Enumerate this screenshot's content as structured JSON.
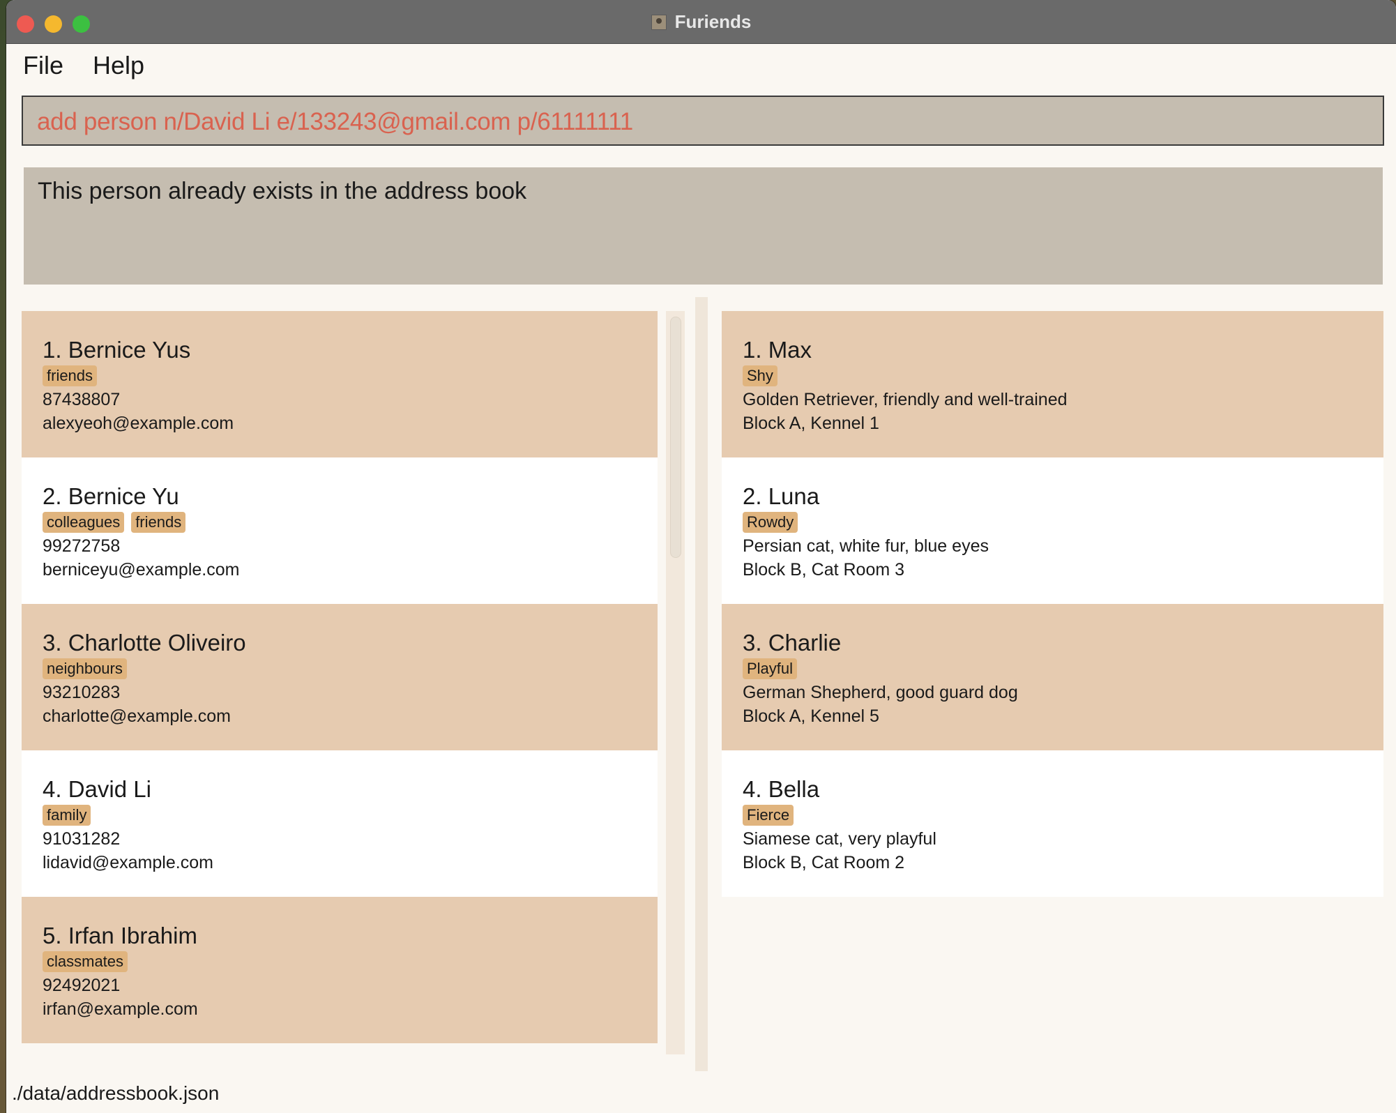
{
  "window": {
    "title": "Furiends"
  },
  "menu": {
    "file": "File",
    "help": "Help"
  },
  "command": {
    "value": "add person n/David Li e/133243@gmail.com p/61111111"
  },
  "result": {
    "message": "This person already exists in the address book"
  },
  "persons": [
    {
      "title": "1. Bernice Yus",
      "tags": [
        "friends"
      ],
      "phone": "87438807",
      "email": "alexyeoh@example.com"
    },
    {
      "title": "2. Bernice Yu",
      "tags": [
        "colleagues",
        "friends"
      ],
      "phone": "99272758",
      "email": "berniceyu@example.com"
    },
    {
      "title": "3. Charlotte Oliveiro",
      "tags": [
        "neighbours"
      ],
      "phone": "93210283",
      "email": "charlotte@example.com"
    },
    {
      "title": "4. David Li",
      "tags": [
        "family"
      ],
      "phone": "91031282",
      "email": "lidavid@example.com"
    },
    {
      "title": "5. Irfan Ibrahim",
      "tags": [
        "classmates"
      ],
      "phone": "92492021",
      "email": "irfan@example.com"
    }
  ],
  "pets": [
    {
      "title": "1. Max",
      "tags": [
        "Shy"
      ],
      "description": "Golden Retriever, friendly and well-trained",
      "location": "Block A, Kennel 1"
    },
    {
      "title": "2. Luna",
      "tags": [
        "Rowdy"
      ],
      "description": "Persian cat, white fur, blue eyes",
      "location": "Block B, Cat Room 3"
    },
    {
      "title": "3. Charlie",
      "tags": [
        "Playful"
      ],
      "description": "German Shepherd, good guard dog",
      "location": "Block A, Kennel 5"
    },
    {
      "title": "4. Bella",
      "tags": [
        "Fierce"
      ],
      "description": "Siamese cat, very playful",
      "location": "Block B, Cat Room 2"
    }
  ],
  "status": {
    "path": "./data/addressbook.json"
  },
  "colors": {
    "card_alt": "#e6cbb0",
    "tag": "#e0b47e",
    "command_text": "#d9624f",
    "panel_bg": "#c5bdb0"
  }
}
